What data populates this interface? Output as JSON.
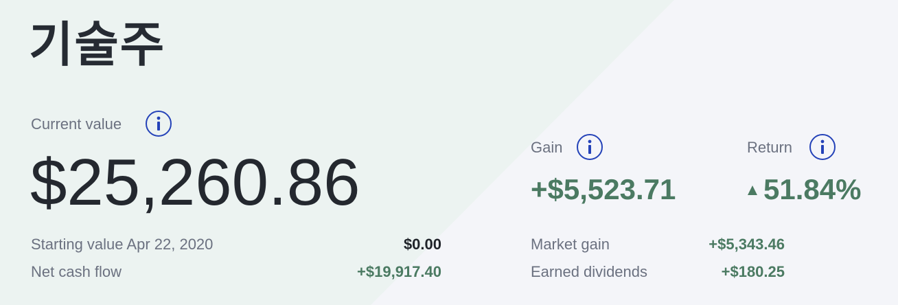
{
  "header": {
    "title": "기술주"
  },
  "current": {
    "label": "Current value",
    "value": "$25,260.86"
  },
  "details": {
    "starting_label": "Starting value Apr 22, 2020",
    "starting_value": "$0.00",
    "netcash_label": "Net cash flow",
    "netcash_value": "+$19,917.40"
  },
  "gain": {
    "label": "Gain",
    "value": "+$5,523.71",
    "market_label": "Market gain",
    "market_value": "+$5,343.46",
    "dividends_label": "Earned dividends",
    "dividends_value": "+$180.25"
  },
  "return": {
    "label": "Return",
    "value": "51.84%",
    "direction_icon": "triangle-up-icon"
  },
  "colors": {
    "positive": "#4b7a62",
    "info_blue": "#2442b8",
    "diagonal_bg": "#ecf3f1",
    "page_bg": "#f4f5f9"
  }
}
